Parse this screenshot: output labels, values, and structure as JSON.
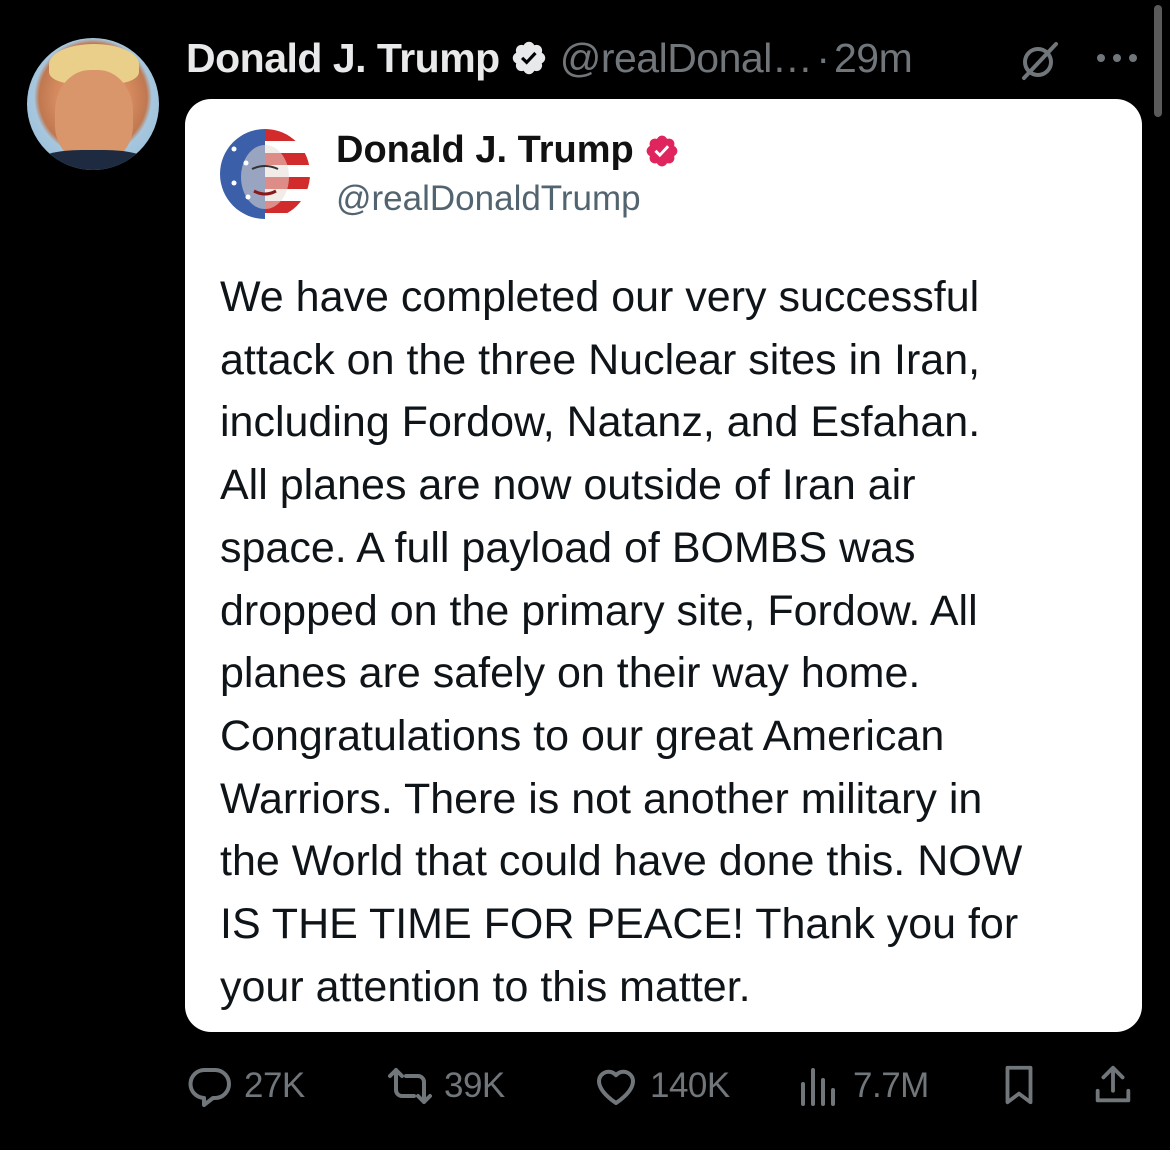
{
  "post": {
    "author_name": "Donald J. Trump",
    "handle": "@realDonal…",
    "separator": "·",
    "time": "29m",
    "icons": {
      "verified": "verified-badge-icon",
      "grok": "grok-icon",
      "more": "more-icon"
    },
    "colors": {
      "background": "#000000",
      "muted": "#71767b",
      "verified": "#1d9bf0"
    }
  },
  "quoted": {
    "author_name": "Donald J. Trump",
    "handle": "@realDonaldTrump",
    "verified_color": "#e0245e",
    "text_lines": [
      "We have completed our very successful",
      "attack on the three Nuclear sites in Iran,",
      "including Fordow, Natanz, and Esfahan.",
      "All planes are now outside of Iran air",
      "space. A full payload of BOMBS was",
      "dropped on the primary site, Fordow. All",
      "planes are safely on their way home.",
      "Congratulations to our great American",
      "Warriors. There is not another military in",
      "the World that could have done this. NOW",
      "IS THE TIME FOR PEACE! Thank you for",
      "your attention to this matter."
    ]
  },
  "actions": {
    "replies": "27K",
    "reposts": "39K",
    "likes": "140K",
    "views": "7.7M",
    "icons": [
      "reply-icon",
      "repost-icon",
      "like-icon",
      "views-icon",
      "bookmark-icon",
      "share-icon"
    ]
  }
}
